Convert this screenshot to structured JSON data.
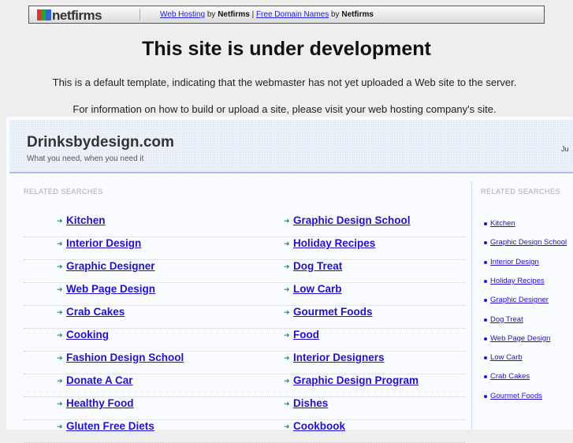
{
  "topbar": {
    "logo": "netfirms",
    "link1": "Web Hosting",
    "by1": "by",
    "brand1": "Netfirms",
    "pipe": "|",
    "link2": "Free Domain Names",
    "by2": "by",
    "brand2": "Netfirms"
  },
  "title": "This site is under development",
  "para1": "This is a default template, indicating that the webmaster has not yet uploaded a Web site to the server.",
  "para2": "For information on how to build or upload a site, please visit your web hosting company's site.",
  "site": {
    "name": "Drinksbydesign.com",
    "tagline": "What you need, when you need it",
    "date": "Ju"
  },
  "related_label": "RELATED SEARCHES",
  "left_col": [
    "Kitchen",
    "Interior Design",
    "Graphic Designer",
    "Web Page Design",
    "Crab Cakes",
    "Cooking",
    "Fashion Design School",
    "Donate A Car",
    "Healthy Food",
    "Gluten Free Diets"
  ],
  "right_col": [
    "Graphic Design School",
    "Holiday Recipes",
    "Dog Treat",
    "Low Carb",
    "Gourmet Foods",
    "Food",
    "Interior Designers",
    "Graphic Design Program",
    "Dishes",
    "Cookbook"
  ],
  "sidebar": [
    "Kitchen",
    "Graphic Design School",
    "Interior Design",
    "Holiday Recipes",
    "Graphic Designer",
    "Dog Treat",
    "Web Page Design",
    "Low Carb",
    "Crab Cakes",
    "Gourmet Foods"
  ]
}
